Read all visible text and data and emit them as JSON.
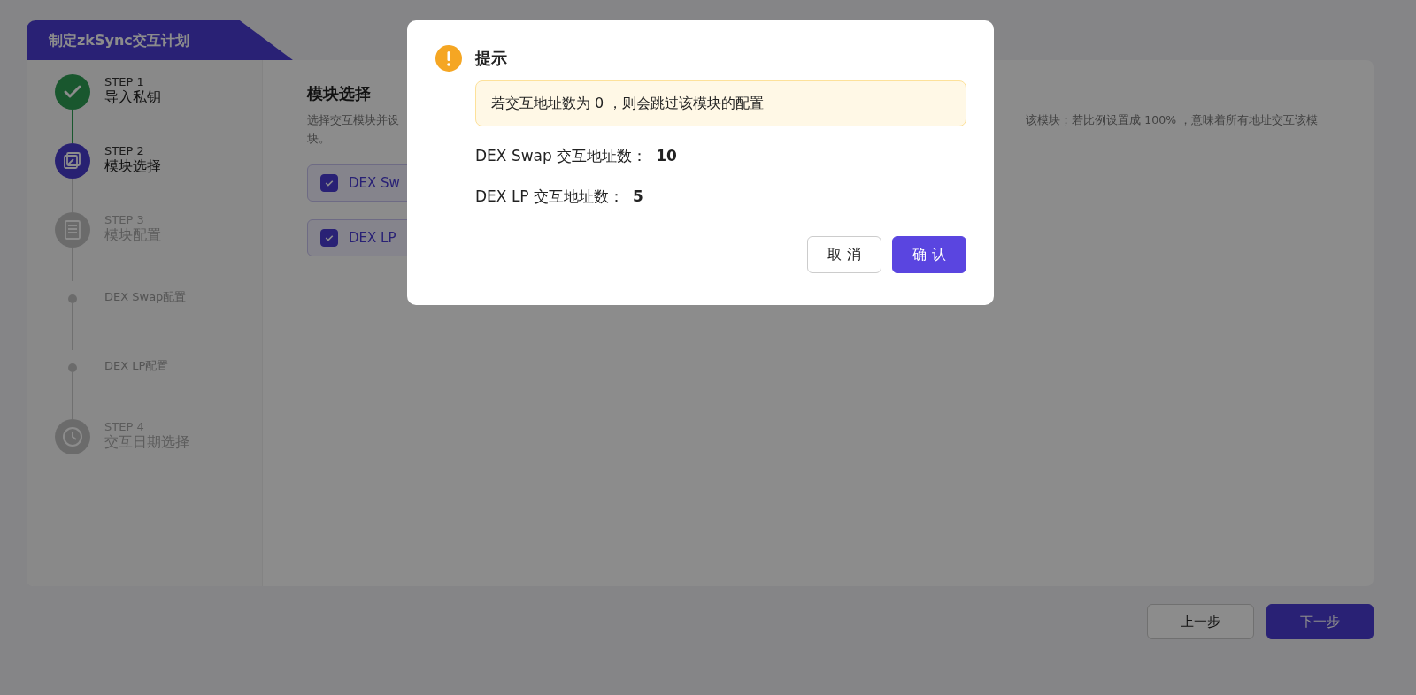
{
  "page_title": "制定zkSync交互计划",
  "steps": [
    {
      "kind": "step",
      "label": "STEP 1",
      "title": "导入私钥",
      "completed": true,
      "selected": false
    },
    {
      "kind": "step",
      "label": "STEP 2",
      "title": "模块选择",
      "completed": false,
      "selected": true
    },
    {
      "kind": "step",
      "label": "STEP 3",
      "title": "模块配置",
      "completed": false,
      "selected": false
    },
    {
      "kind": "sub",
      "title": "DEX Swap配置",
      "completed": false,
      "selected": false
    },
    {
      "kind": "sub",
      "title": "DEX LP配置",
      "completed": false,
      "selected": false
    },
    {
      "kind": "step",
      "label": "STEP 4",
      "title": "交互日期选择",
      "completed": false,
      "selected": false
    }
  ],
  "section": {
    "title": "模块选择",
    "description_start": "选择交互模块并设",
    "description_end": "该模块；若比例设置成 100% ，意味着所有地址交互该模",
    "description_line_2": "块。"
  },
  "modules": [
    {
      "label": "DEX Sw",
      "checked": true
    },
    {
      "label": "DEX LP",
      "checked": true
    }
  ],
  "footer_buttons": [
    {
      "label": "上一步",
      "kind": "secondary"
    },
    {
      "label": "下一步",
      "kind": "primary"
    }
  ],
  "dialog": {
    "title": "提示",
    "notice": "若交互地址数为 0 ，则会跳过该模块的配置",
    "rows": [
      {
        "label": "DEX Swap 交互地址数：",
        "value": "10"
      },
      {
        "label": "DEX LP 交互地址数：",
        "value": "5"
      }
    ],
    "buttons": [
      {
        "label": "取 消",
        "kind": "secondary"
      },
      {
        "label": "确 认",
        "kind": "primary"
      }
    ]
  }
}
